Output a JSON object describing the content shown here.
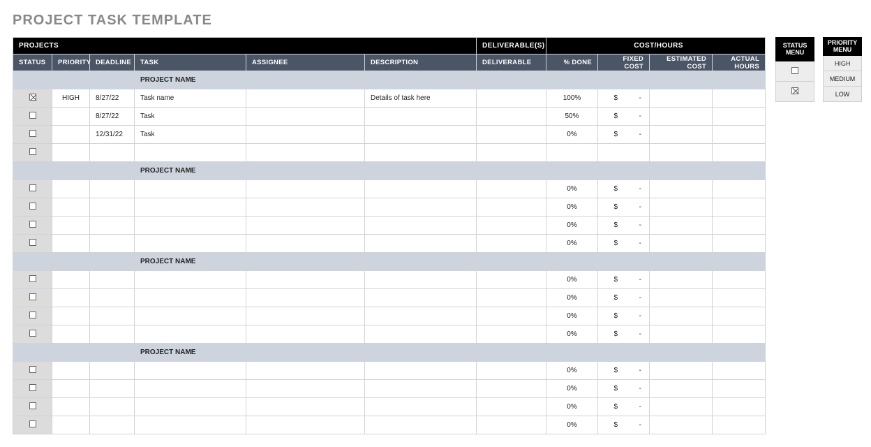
{
  "title": "PROJECT TASK TEMPLATE",
  "topband": {
    "projects": "PROJECTS",
    "deliverables": "DELIVERABLE(S)",
    "costhours": "COST/HOURS"
  },
  "columns": {
    "status": "STATUS",
    "priority": "PRIORITY",
    "deadline": "DEADLINE",
    "task": "TASK",
    "assignee": "ASSIGNEE",
    "description": "DESCRIPTION",
    "deliverable": "DELIVERABLE",
    "pctdone": "% DONE",
    "fixedcost": "FIXED COST",
    "estcost": "ESTIMATED COST",
    "actualhours": "ACTUAL HOURS"
  },
  "section_label": "PROJECT NAME",
  "currency": "$",
  "dash": "-",
  "groups": [
    {
      "rows": [
        {
          "checked": true,
          "priority": "HIGH",
          "deadline": "8/27/22",
          "task": "Task name",
          "assignee": "",
          "description": "Details of task here",
          "deliverable": "",
          "pctdone": "100%",
          "fixedcost": true,
          "estcost": "",
          "actualhours": ""
        },
        {
          "checked": false,
          "priority": "",
          "deadline": "8/27/22",
          "task": "Task",
          "assignee": "",
          "description": "",
          "deliverable": "",
          "pctdone": "50%",
          "fixedcost": true,
          "estcost": "",
          "actualhours": ""
        },
        {
          "checked": false,
          "priority": "",
          "deadline": "12/31/22",
          "task": "Task",
          "assignee": "",
          "description": "",
          "deliverable": "",
          "pctdone": "0%",
          "fixedcost": true,
          "estcost": "",
          "actualhours": ""
        },
        {
          "checked": false,
          "priority": "",
          "deadline": "",
          "task": "",
          "assignee": "",
          "description": "",
          "deliverable": "",
          "pctdone": "",
          "fixedcost": false,
          "estcost": "",
          "actualhours": ""
        }
      ]
    },
    {
      "rows": [
        {
          "checked": false,
          "priority": "",
          "deadline": "",
          "task": "",
          "assignee": "",
          "description": "",
          "deliverable": "",
          "pctdone": "0%",
          "fixedcost": true,
          "estcost": "",
          "actualhours": ""
        },
        {
          "checked": false,
          "priority": "",
          "deadline": "",
          "task": "",
          "assignee": "",
          "description": "",
          "deliverable": "",
          "pctdone": "0%",
          "fixedcost": true,
          "estcost": "",
          "actualhours": ""
        },
        {
          "checked": false,
          "priority": "",
          "deadline": "",
          "task": "",
          "assignee": "",
          "description": "",
          "deliverable": "",
          "pctdone": "0%",
          "fixedcost": true,
          "estcost": "",
          "actualhours": ""
        },
        {
          "checked": false,
          "priority": "",
          "deadline": "",
          "task": "",
          "assignee": "",
          "description": "",
          "deliverable": "",
          "pctdone": "0%",
          "fixedcost": true,
          "estcost": "",
          "actualhours": ""
        }
      ]
    },
    {
      "rows": [
        {
          "checked": false,
          "priority": "",
          "deadline": "",
          "task": "",
          "assignee": "",
          "description": "",
          "deliverable": "",
          "pctdone": "0%",
          "fixedcost": true,
          "estcost": "",
          "actualhours": ""
        },
        {
          "checked": false,
          "priority": "",
          "deadline": "",
          "task": "",
          "assignee": "",
          "description": "",
          "deliverable": "",
          "pctdone": "0%",
          "fixedcost": true,
          "estcost": "",
          "actualhours": ""
        },
        {
          "checked": false,
          "priority": "",
          "deadline": "",
          "task": "",
          "assignee": "",
          "description": "",
          "deliverable": "",
          "pctdone": "0%",
          "fixedcost": true,
          "estcost": "",
          "actualhours": ""
        },
        {
          "checked": false,
          "priority": "",
          "deadline": "",
          "task": "",
          "assignee": "",
          "description": "",
          "deliverable": "",
          "pctdone": "0%",
          "fixedcost": true,
          "estcost": "",
          "actualhours": ""
        }
      ]
    },
    {
      "rows": [
        {
          "checked": false,
          "priority": "",
          "deadline": "",
          "task": "",
          "assignee": "",
          "description": "",
          "deliverable": "",
          "pctdone": "0%",
          "fixedcost": true,
          "estcost": "",
          "actualhours": ""
        },
        {
          "checked": false,
          "priority": "",
          "deadline": "",
          "task": "",
          "assignee": "",
          "description": "",
          "deliverable": "",
          "pctdone": "0%",
          "fixedcost": true,
          "estcost": "",
          "actualhours": ""
        },
        {
          "checked": false,
          "priority": "",
          "deadline": "",
          "task": "",
          "assignee": "",
          "description": "",
          "deliverable": "",
          "pctdone": "0%",
          "fixedcost": true,
          "estcost": "",
          "actualhours": ""
        },
        {
          "checked": false,
          "priority": "",
          "deadline": "",
          "task": "",
          "assignee": "",
          "description": "",
          "deliverable": "",
          "pctdone": "0%",
          "fixedcost": true,
          "estcost": "",
          "actualhours": ""
        }
      ]
    }
  ],
  "status_menu": {
    "title": "STATUS MENU",
    "items": [
      {
        "checked": false
      },
      {
        "checked": true
      }
    ]
  },
  "priority_menu": {
    "title": "PRIORITY MENU",
    "items": [
      "HIGH",
      "MEDIUM",
      "LOW"
    ]
  }
}
